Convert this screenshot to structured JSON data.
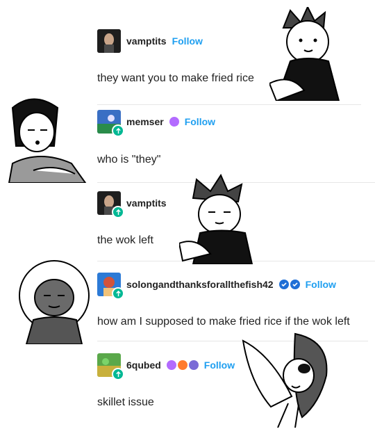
{
  "posts": [
    {
      "username": "vamptits",
      "follow": "Follow",
      "text": "they want you to make fried rice",
      "reblog": false,
      "avatar": "avatar-vamptits"
    },
    {
      "username": "memser",
      "follow": "Follow",
      "text": "who is \"they\"",
      "reblog": true,
      "avatar": "avatar-memser"
    },
    {
      "username": "vamptits",
      "follow": "",
      "text": "the wok left",
      "reblog": true,
      "avatar": "avatar-vamptits"
    },
    {
      "username": "solongandthanksforallthefish42",
      "follow": "Follow",
      "text": "how am I supposed to make fried rice if the wok left",
      "reblog": true,
      "avatar": "avatar-solong"
    },
    {
      "username": "6qubed",
      "follow": "Follow",
      "text": "skillet issue",
      "reblog": true,
      "avatar": "avatar-6qubed"
    }
  ],
  "colors": {
    "follow": "#1f9ff0",
    "reblog": "#00b894",
    "divider": "#e6e6e6"
  }
}
